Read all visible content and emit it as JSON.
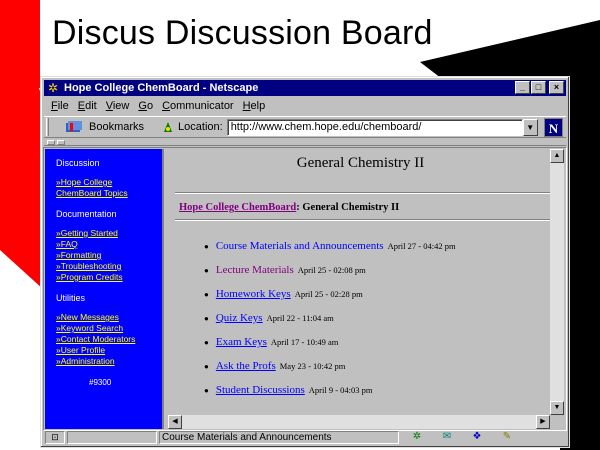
{
  "slide": {
    "title": "Discus Discussion Board"
  },
  "window": {
    "title": "Hope College ChemBoard - Netscape",
    "minimize_glyph": "_",
    "maximize_glyph": "□",
    "close_glyph": "×"
  },
  "menubar": [
    "File",
    "Edit",
    "View",
    "Go",
    "Communicator",
    "Help"
  ],
  "toolbar": {
    "bookmarks_label": "Bookmarks",
    "location_label": "Location:",
    "url": "http://www.chem.hope.edu/chemboard/"
  },
  "sidebar": {
    "section_discussion": "Discussion",
    "topics_link_line1": "»Hope College",
    "topics_link_line2": "ChemBoard Topics",
    "section_documentation": "Documentation",
    "doc_links": [
      "»Getting Started",
      "»FAQ",
      "»Formatting",
      "»Troubleshooting",
      "»Program Credits"
    ],
    "section_utilities": "Utilities",
    "util_links": [
      "»New Messages",
      "»Keyword Search",
      "»Contact Moderators",
      "»User Profile",
      "»Administration"
    ],
    "counter": "#9300"
  },
  "main": {
    "title": "General Chemistry II",
    "breadcrumb_link": "Hope College ChemBoard",
    "breadcrumb_rest": ": General Chemistry II",
    "topics": [
      {
        "label": "Course Materials and Announcements",
        "date": "April 27 - 04:42 pm",
        "style": "nodeco"
      },
      {
        "label": "Lecture Materials",
        "date": "April 25 - 02:08 pm",
        "style": "visited"
      },
      {
        "label": "Homework Keys",
        "date": "April 25 - 02:28 pm",
        "style": "link"
      },
      {
        "label": "Quiz Keys",
        "date": "April 22 - 11:04 am",
        "style": "link"
      },
      {
        "label": "Exam Keys",
        "date": "April 17 - 10:49 am",
        "style": "link"
      },
      {
        "label": "Ask the Profs",
        "date": "May 23 - 10:42 pm",
        "style": "link"
      },
      {
        "label": "Student Discussions",
        "date": "April 9 - 04:03 pm",
        "style": "link"
      }
    ]
  },
  "statusbar": {
    "text": "Course Materials and Announcements"
  },
  "colors": {
    "titlebar": "#000080",
    "sidebar": "#0000ff",
    "sidebar_link": "#ffff00",
    "slide_accent": "#ff0000"
  }
}
